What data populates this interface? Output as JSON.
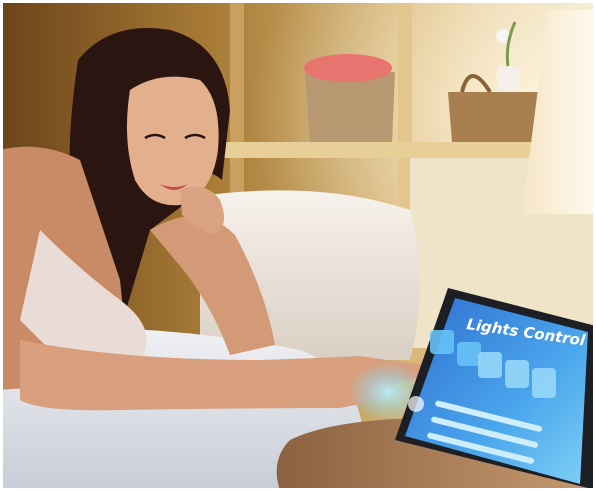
{
  "photo": {
    "tablet_screen": {
      "title": "Lights Control",
      "tiles_row1": 5,
      "sliders": 3
    },
    "colors": {
      "wall_warm": "#b8893c",
      "wall_shadow": "#5a3a18",
      "shelf_wood": "#e8c98a",
      "pillow": "#efe9e2",
      "sheet": "#e7e9ee",
      "skin": "#d8a07e",
      "hair": "#2a1510",
      "lamp_shade": "#fbf3e0",
      "tablet_screen": "#3f8fe0",
      "tablet_glow": "#9fe0ff",
      "side_table": "#a67a54"
    }
  }
}
